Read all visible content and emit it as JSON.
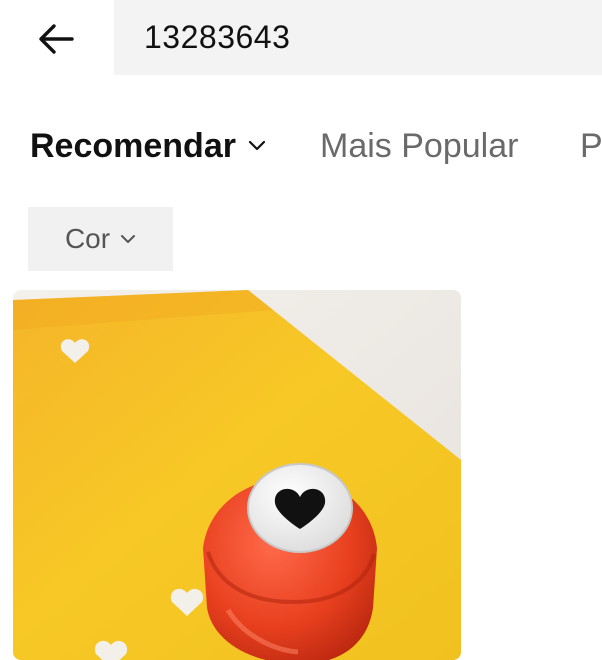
{
  "search": {
    "query": "13283643"
  },
  "sort_tabs": [
    {
      "label": "Recomendar",
      "active": true
    },
    {
      "label": "Mais Popular",
      "active": false
    },
    {
      "label": "P",
      "active": false
    }
  ],
  "filter": {
    "label": "Cor"
  },
  "product": {
    "image": "heart-paper-punch-on-yellow-paper"
  },
  "icons": {
    "back": "arrow-left-icon",
    "dropdown": "chevron-down-icon"
  },
  "colors": {
    "active_text": "#111111",
    "inactive_text": "#6a6a6a",
    "chip_bg": "#f1f1f1",
    "search_bg": "#f3f3f3"
  }
}
